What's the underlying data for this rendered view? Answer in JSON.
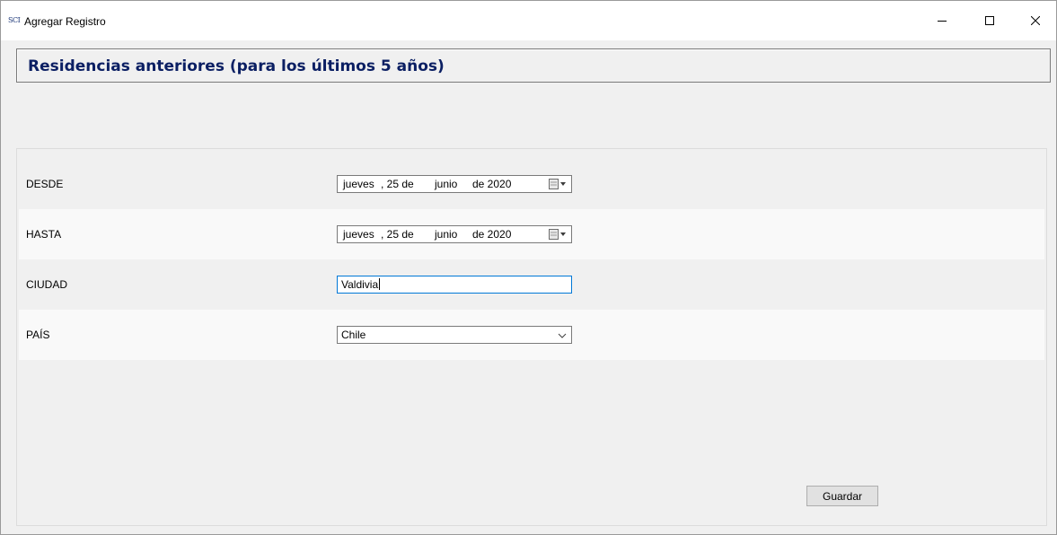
{
  "window": {
    "app_icon_text": "SCI",
    "title": "Agregar Registro"
  },
  "header": {
    "title": "Residencias anteriores (para los últimos 5 años)"
  },
  "form": {
    "desde": {
      "label": "DESDE",
      "weekday": "jueves",
      "day": ", 25 de",
      "month": "junio",
      "year": "de 2020"
    },
    "hasta": {
      "label": "HASTA",
      "weekday": "jueves",
      "day": ", 25 de",
      "month": "junio",
      "year": "de 2020"
    },
    "ciudad": {
      "label": "CIUDAD",
      "value": "Valdivia"
    },
    "pais": {
      "label": "PAÍS",
      "value": "Chile"
    }
  },
  "actions": {
    "save_label": "Guardar"
  },
  "colors": {
    "header_text": "#0b1f63",
    "focus_border": "#0078d7",
    "window_bg": "#f0f0f0"
  }
}
